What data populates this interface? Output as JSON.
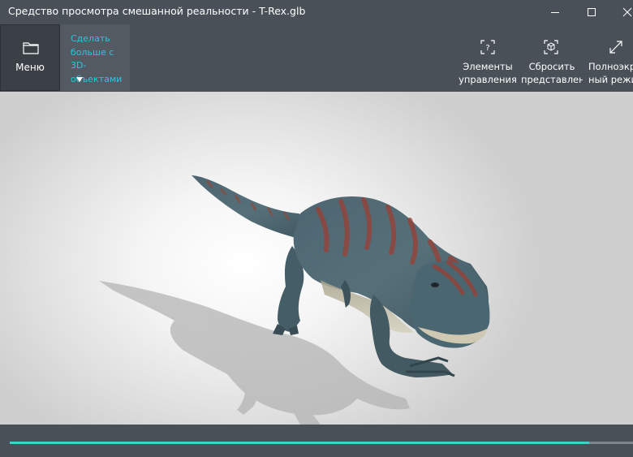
{
  "window": {
    "title": "Средство просмотра смешанной реальности - T-Rex.glb"
  },
  "toolbar": {
    "menu_label": "Меню",
    "promo_lines": [
      "Сделать",
      "больше с",
      "3D-",
      "объектами"
    ],
    "controls_label_line1": "Элементы",
    "controls_label_line2": "управления",
    "reset_label_line1": "Сбросить",
    "reset_label_line2": "представлен",
    "fullscreen_label_line1": "Полноэкр",
    "fullscreen_label_line2": "ный режи"
  },
  "icons": {
    "menu": "folder-icon",
    "controls": "help-controls-icon",
    "reset": "reset-view-cube-icon",
    "fullscreen": "fullscreen-expand-icon"
  },
  "animation": {
    "progress": 0.93
  },
  "colors": {
    "accent": "#2fc3e3",
    "progress": "#3fd2c4",
    "chrome": "#4a5058"
  }
}
